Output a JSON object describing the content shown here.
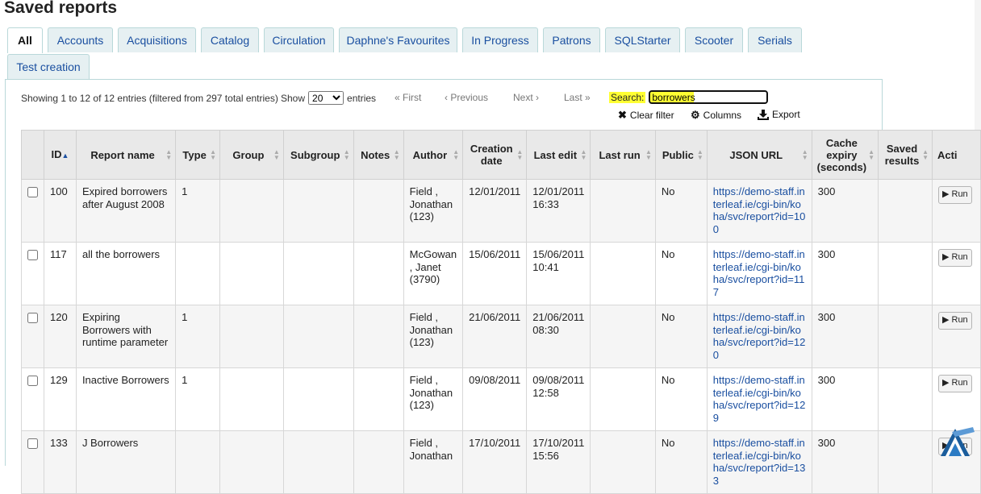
{
  "page": {
    "title": "Saved reports"
  },
  "tabs": [
    {
      "label": "All"
    },
    {
      "label": "Accounts"
    },
    {
      "label": "Acquisitions"
    },
    {
      "label": "Catalog"
    },
    {
      "label": "Circulation"
    },
    {
      "label": "Daphne's Favourites"
    },
    {
      "label": "In Progress"
    },
    {
      "label": "Patrons"
    },
    {
      "label": "SQLStarter"
    },
    {
      "label": "Scooter"
    },
    {
      "label": "Serials"
    },
    {
      "label": "Test creation"
    }
  ],
  "table_controls": {
    "info": "Showing 1 to 12 of 12 entries (filtered from 297 total entries)",
    "show_label": "Show",
    "page_size": "20",
    "entries_label": "entries",
    "first": "« First",
    "previous": "‹ Previous",
    "next": "Next ›",
    "last": "Last »",
    "search_label": "Search:",
    "search_value": "borrowers",
    "clear_filter": "Clear filter",
    "columns": "Columns",
    "export": "Export"
  },
  "columns": [
    "ID",
    "Report name",
    "Type",
    "Group",
    "Subgroup",
    "Notes",
    "Author",
    "Creation date",
    "Last edit",
    "Last run",
    "Public",
    "JSON URL",
    "Cache expiry (seconds)",
    "Saved results",
    "Acti"
  ],
  "rows": [
    {
      "id": "100",
      "name": "Expired borrowers after August 2008",
      "type": "1",
      "group": "",
      "subgroup": "",
      "notes": "",
      "author": "Field , Jonathan (123)",
      "created": "12/01/2011",
      "edited": "12/01/2011 16:33",
      "last_run": "",
      "public": "No",
      "json_url": "https://demo-staff.interleaf.ie/cgi-bin/koha/svc/report?id=100",
      "cache": "300",
      "saved": "",
      "action": "▶ Run"
    },
    {
      "id": "117",
      "name": "all the borrowers",
      "type": "",
      "group": "",
      "subgroup": "",
      "notes": "",
      "author": "McGowan , Janet (3790)",
      "created": "15/06/2011",
      "edited": "15/06/2011 10:41",
      "last_run": "",
      "public": "No",
      "json_url": "https://demo-staff.interleaf.ie/cgi-bin/koha/svc/report?id=117",
      "cache": "300",
      "saved": "",
      "action": "▶ Run"
    },
    {
      "id": "120",
      "name": "Expiring Borrowers with runtime parameter",
      "type": "1",
      "group": "",
      "subgroup": "",
      "notes": "",
      "author": "Field , Jonathan (123)",
      "created": "21/06/2011",
      "edited": "21/06/2011 08:30",
      "last_run": "",
      "public": "No",
      "json_url": "https://demo-staff.interleaf.ie/cgi-bin/koha/svc/report?id=120",
      "cache": "300",
      "saved": "",
      "action": "▶ Run"
    },
    {
      "id": "129",
      "name": "Inactive Borrowers",
      "type": "1",
      "group": "",
      "subgroup": "",
      "notes": "",
      "author": "Field , Jonathan (123)",
      "created": "09/08/2011",
      "edited": "09/08/2011 12:58",
      "last_run": "",
      "public": "No",
      "json_url": "https://demo-staff.interleaf.ie/cgi-bin/koha/svc/report?id=129",
      "cache": "300",
      "saved": "",
      "action": "▶ Run"
    },
    {
      "id": "133",
      "name": "J Borrowers",
      "type": "",
      "group": "",
      "subgroup": "",
      "notes": "",
      "author": "Field , Jonathan",
      "created": "17/10/2011",
      "edited": "17/10/2011 15:56",
      "last_run": "",
      "public": "No",
      "json_url": "https://demo-staff.interleaf.ie/cgi-bin/koha/svc/report?id=133",
      "cache": "300",
      "saved": "",
      "action": "▶ Run"
    }
  ]
}
